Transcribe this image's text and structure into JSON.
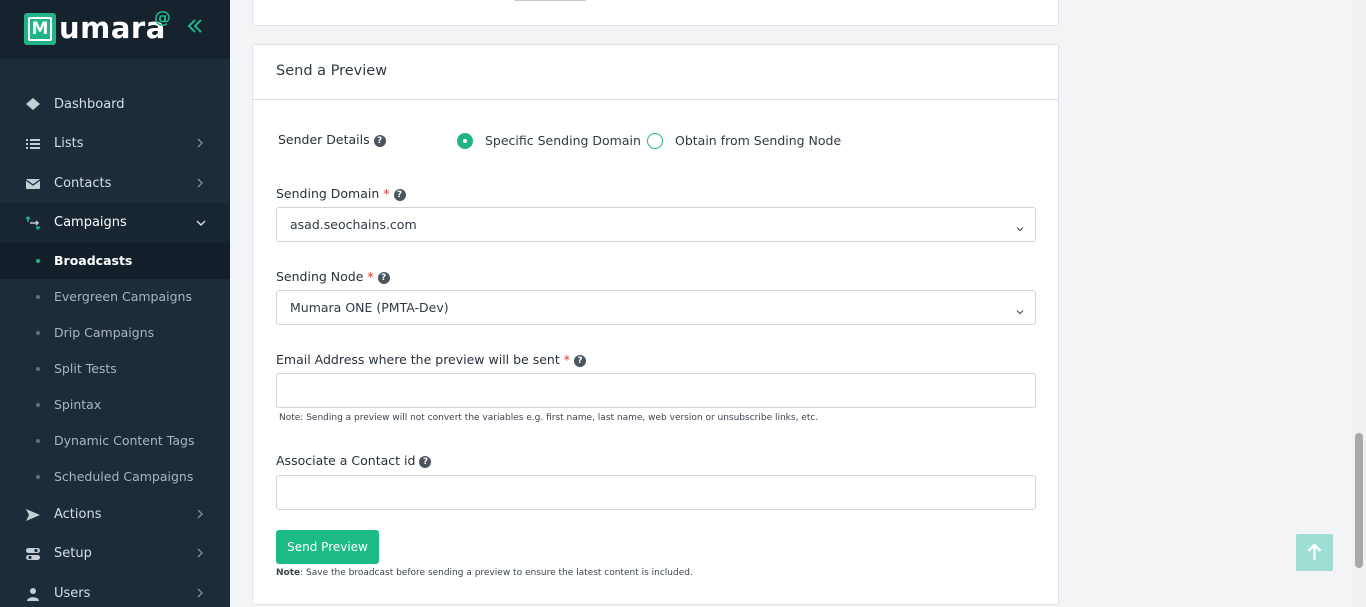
{
  "brand": {
    "name": "umara",
    "letter": "M",
    "superscript": "@"
  },
  "sidebar": {
    "items": [
      {
        "label": "Dashboard",
        "icon": "dashboard-icon",
        "chevron": false
      },
      {
        "label": "Lists",
        "icon": "list-icon",
        "chevron": "right"
      },
      {
        "label": "Contacts",
        "icon": "envelope-icon",
        "chevron": "right"
      },
      {
        "label": "Campaigns",
        "icon": "campaigns-icon",
        "chevron": "down",
        "active": true
      },
      {
        "label": "Actions",
        "icon": "paper-plane-icon",
        "chevron": "right"
      },
      {
        "label": "Setup",
        "icon": "toggle-icon",
        "chevron": "right"
      },
      {
        "label": "Users",
        "icon": "user-icon",
        "chevron": "right"
      }
    ],
    "subitems": [
      {
        "label": "Broadcasts",
        "active": true
      },
      {
        "label": "Evergreen Campaigns"
      },
      {
        "label": "Drip Campaigns"
      },
      {
        "label": "Split Tests"
      },
      {
        "label": "Spintax"
      },
      {
        "label": "Dynamic Content Tags"
      },
      {
        "label": "Scheduled Campaigns"
      }
    ]
  },
  "preview": {
    "title": "Send a Preview",
    "sender_details_label": "Sender Details",
    "radio_specific": "Specific Sending Domain",
    "radio_node": "Obtain from Sending Node",
    "sending_domain_label": "Sending Domain",
    "sending_domain_value": "asad.seochains.com",
    "sending_node_label": "Sending Node",
    "sending_node_value": "Mumara ONE (PMTA-Dev)",
    "email_label": "Email Address where the preview will be sent",
    "email_value": "",
    "email_note": "Note: Sending a preview will not convert the variables e.g. first name, last name, web version or unsubscribe links, etc.",
    "contact_label": "Associate a Contact id",
    "contact_value": "",
    "button_label": "Send Preview",
    "footer_note_bold": "Note",
    "footer_note": ": Save the broadcast before sending a preview to ensure the latest content is included.",
    "required_mark": "*",
    "help_glyph": "?"
  },
  "colors": {
    "accent": "#20b486",
    "sidebar_bg": "#1d2c3b",
    "button_bg": "#1dbb86"
  }
}
